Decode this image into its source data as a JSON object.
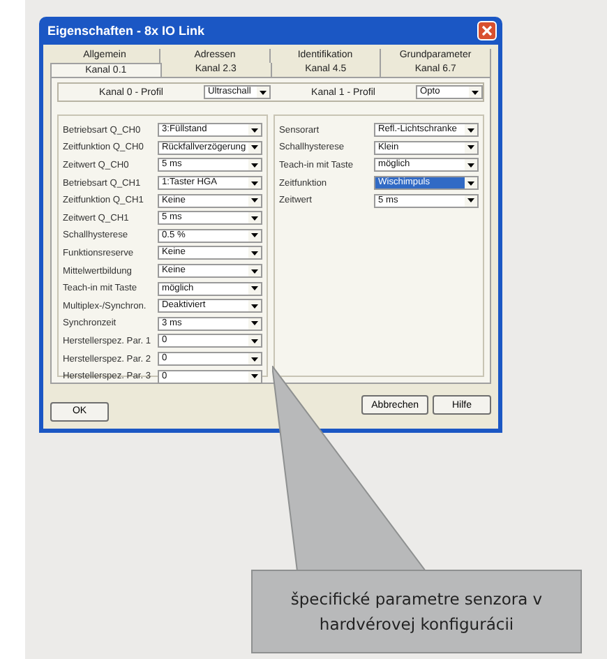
{
  "window": {
    "title": "Eigenschaften - 8x IO Link"
  },
  "tab_rows": [
    [
      {
        "label": "Allgemein",
        "selected": false
      },
      {
        "label": "Adressen",
        "selected": false
      },
      {
        "label": "Identifikation",
        "selected": false
      },
      {
        "label": "Grundparameter",
        "selected": false
      }
    ],
    [
      {
        "label": "Kanal 0.1",
        "selected": true
      },
      {
        "label": "Kanal 2.3",
        "selected": false
      },
      {
        "label": "Kanal 4.5",
        "selected": false
      },
      {
        "label": "Kanal 6.7",
        "selected": false
      }
    ]
  ],
  "profiles": [
    {
      "label": "Kanal 0 - Profil",
      "value": "Ultraschall"
    },
    {
      "label": "Kanal 1 - Profil",
      "value": "Opto"
    }
  ],
  "channel_0_fields": [
    {
      "label": "Betriebsart Q_CH0",
      "value": "3:Füllstand",
      "selected": false
    },
    {
      "label": "Zeitfunktion Q_CH0",
      "value": "Rückfallverzögerung",
      "selected": false
    },
    {
      "label": "Zeitwert Q_CH0",
      "value": "5 ms",
      "selected": false
    },
    {
      "label": "Betriebsart Q_CH1",
      "value": "1:Taster HGA",
      "selected": false
    },
    {
      "label": "Zeitfunktion Q_CH1",
      "value": "Keine",
      "selected": false
    },
    {
      "label": "Zeitwert Q_CH1",
      "value": "5 ms",
      "selected": false
    },
    {
      "label": "Schallhysterese",
      "value": "0.5 %",
      "selected": false
    },
    {
      "label": "Funktionsreserve",
      "value": "Keine",
      "selected": false
    },
    {
      "label": "Mittelwertbildung",
      "value": "Keine",
      "selected": false
    },
    {
      "label": "Teach-in mit Taste",
      "value": "möglich",
      "selected": false
    },
    {
      "label": "Multiplex-/Synchron.",
      "value": "Deaktiviert",
      "selected": false
    },
    {
      "label": "Synchronzeit",
      "value": "3 ms",
      "selected": false
    },
    {
      "label": "Herstellerspez. Par. 1",
      "value": "0",
      "selected": false
    },
    {
      "label": "Herstellerspez. Par. 2",
      "value": "0",
      "selected": false
    },
    {
      "label": "Herstellerspez. Par. 3",
      "value": "0",
      "selected": false
    }
  ],
  "channel_1_fields": [
    {
      "label": "Sensorart",
      "value": "Refl.-Lichtschranke",
      "selected": false
    },
    {
      "label": "Schallhysterese",
      "value": "Klein",
      "selected": false
    },
    {
      "label": "Teach-in mit Taste",
      "value": "möglich",
      "selected": false
    },
    {
      "label": "Zeitfunktion",
      "value": "Wischimpuls",
      "selected": true
    },
    {
      "label": "Zeitwert",
      "value": "5 ms",
      "selected": false
    }
  ],
  "buttons": {
    "left": [
      "OK"
    ],
    "right": [
      "Abbrechen",
      "Hilfe"
    ]
  },
  "callout": {
    "text": "špecifické parametre senzora v hardvérovej konfigurácii"
  }
}
